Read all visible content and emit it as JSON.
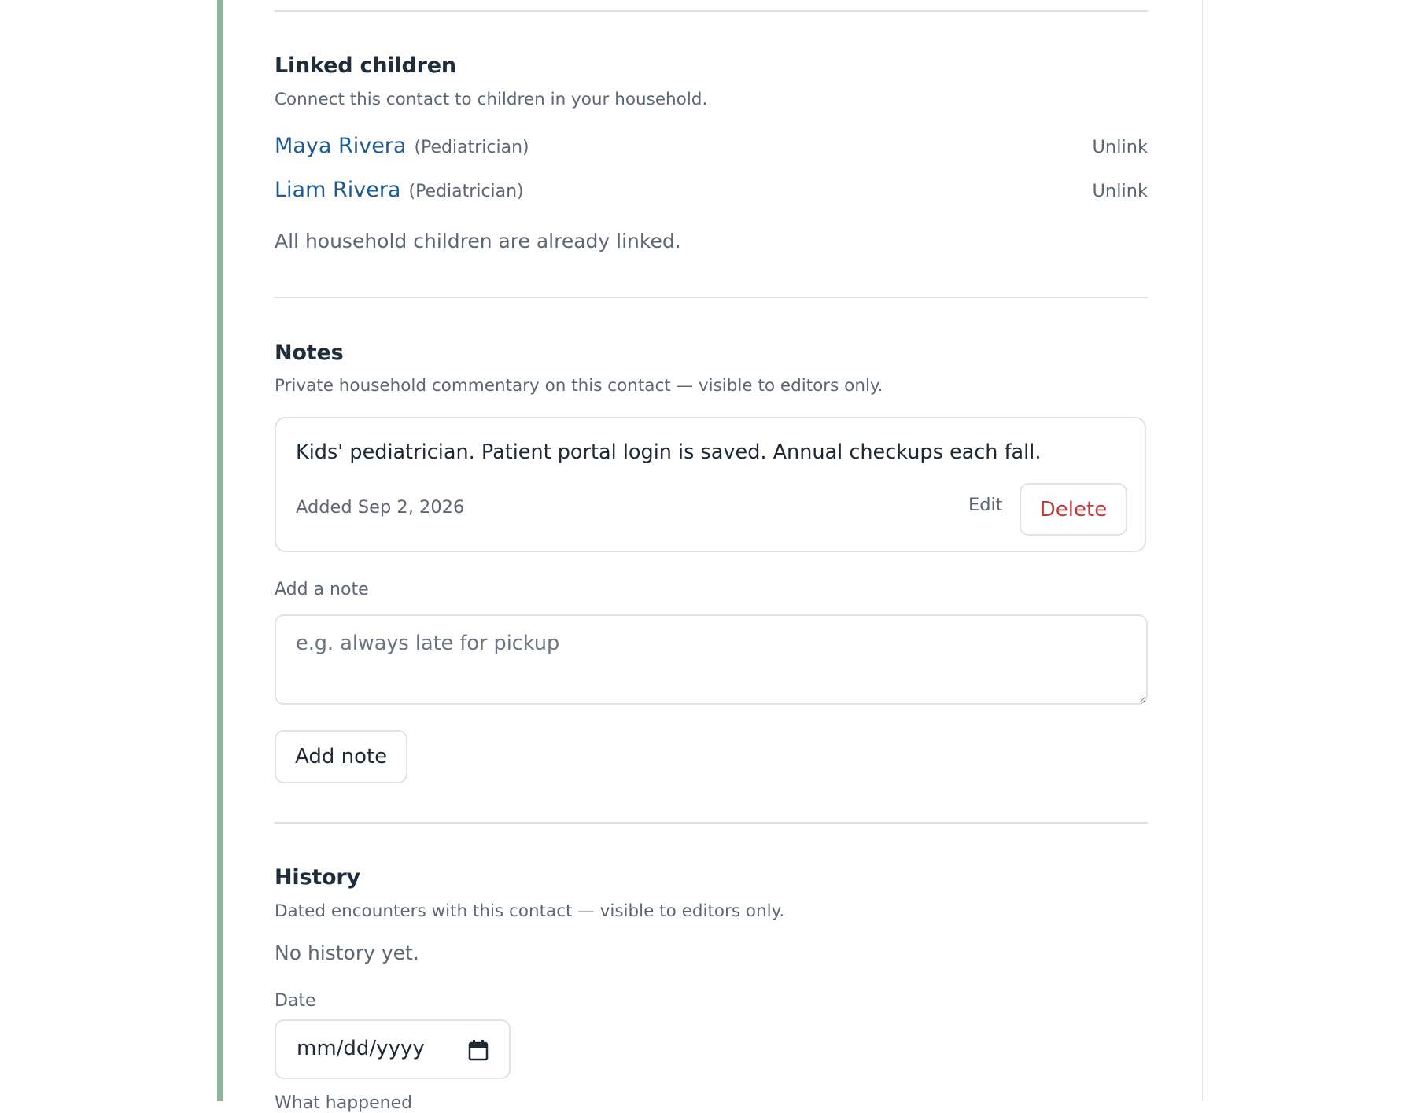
{
  "linked_children": {
    "title": "Linked children",
    "subtitle": "Connect this contact to children in your household.",
    "children": [
      {
        "name": "Maya Rivera",
        "role": "(Pediatrician)",
        "action": "Unlink"
      },
      {
        "name": "Liam Rivera",
        "role": "(Pediatrician)",
        "action": "Unlink"
      }
    ],
    "status": "All household children are already linked."
  },
  "notes": {
    "title": "Notes",
    "subtitle": "Private household commentary on this contact — visible to editors only.",
    "items": [
      {
        "text": "Kids' pediatrician. Patient portal login is saved. Annual checkups each fall.",
        "date": "Added Sep 2, 2026",
        "edit_label": "Edit",
        "delete_label": "Delete"
      }
    ],
    "add_label": "Add a note",
    "add_placeholder": "e.g. always late for pickup",
    "add_button": "Add note"
  },
  "history": {
    "title": "History",
    "subtitle": "Dated encounters with this contact — visible to editors only.",
    "empty": "No history yet.",
    "date_label": "Date",
    "date_placeholder": "mm/dd/yyyy",
    "what_label": "What happened"
  },
  "colors": {
    "accent": "#8fb39b",
    "link": "#1e5a93",
    "danger": "#c0393b"
  }
}
